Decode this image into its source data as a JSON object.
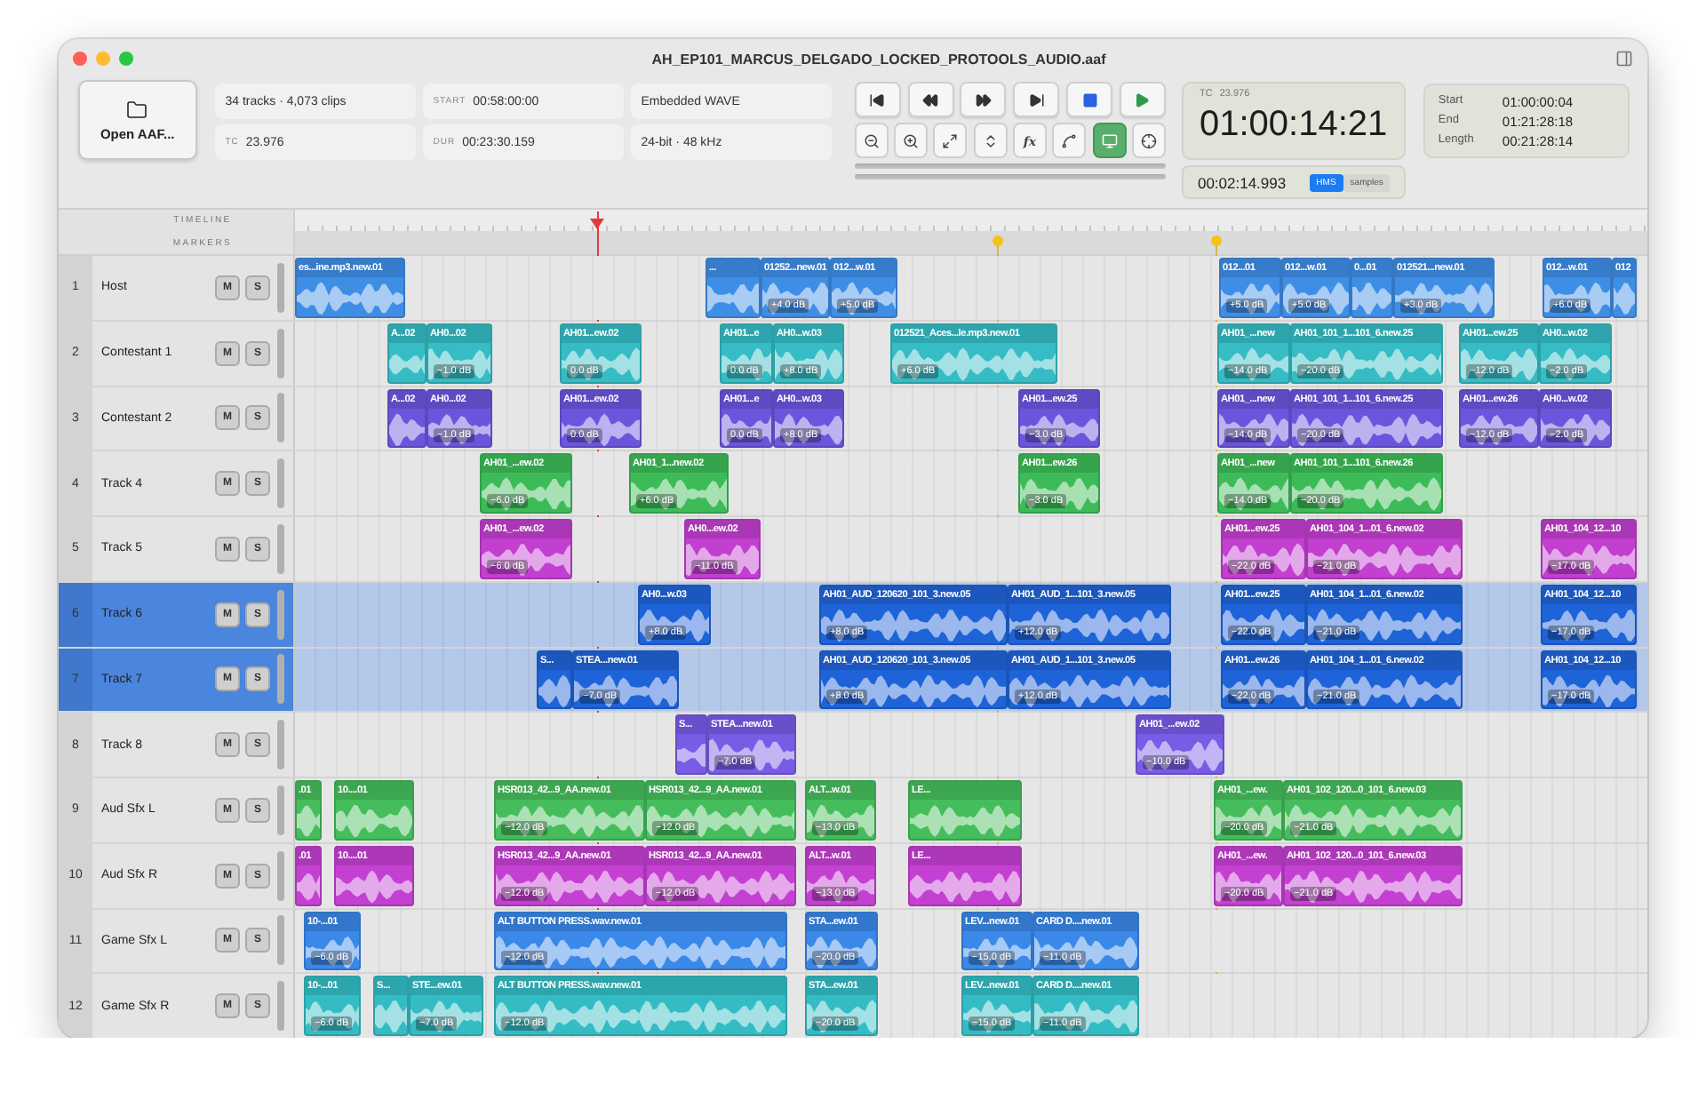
{
  "window": {
    "title": "AH_EP101_MARCUS_DELGADO_LOCKED_PROTOOLS_AUDIO.aaf"
  },
  "toolbar": {
    "open_button": "Open AAF...",
    "info": [
      {
        "value": "34 tracks · 4,073 clips"
      },
      {
        "label": "START",
        "value": "00:58:00:00"
      },
      {
        "value": "Embedded WAVE"
      },
      {
        "label": "TC",
        "value": "23.976"
      },
      {
        "label": "DUR",
        "value": "00:23:30.159"
      },
      {
        "value": "24-bit · 48 kHz"
      }
    ],
    "tools": [
      {
        "selected": false
      },
      {
        "selected": false
      },
      {
        "selected": false
      },
      {
        "selected": false
      },
      {
        "label": "fx",
        "selected": false
      },
      {
        "selected": false
      },
      {
        "selected": true
      },
      {
        "selected": false
      }
    ]
  },
  "timecode": {
    "rate_label": "TC",
    "rate": "23.976",
    "main": "01:00:14:21",
    "secondary": "00:02:14.993",
    "formats": [
      {
        "label": "HMS",
        "selected": true
      },
      {
        "label": "samples",
        "selected": false
      }
    ]
  },
  "range": [
    {
      "label": "Start",
      "value": "01:00:00:04"
    },
    {
      "label": "End",
      "value": "01:21:28:18"
    },
    {
      "label": "Length",
      "value": "00:21:28:14"
    }
  ],
  "ruler": {
    "timeline_label": "TIMELINE",
    "markers_label": "MARKERS"
  },
  "tracks": [
    {
      "number": "1",
      "name": "Host",
      "color": "#3f8ee6",
      "selected": false,
      "mute": "M",
      "solo": "S",
      "clips": [
        {
          "label": "es...ine.mp3.new.01"
        },
        {
          "label": "..."
        },
        {
          "label": "01252...new.01",
          "gain": "+4.0 dB"
        },
        {
          "label": "012...w.01",
          "gain": "+5.0 dB"
        },
        {
          "label": "012...01",
          "gain": "+5.0 dB"
        },
        {
          "label": "012...w.01",
          "gain": "+5.0 dB"
        },
        {
          "label": "0...01"
        },
        {
          "label": "012521...new.01",
          "gain": "+3.0 dB"
        },
        {
          "label": "012...w.01",
          "gain": "+6.0 dB"
        },
        {
          "label": "012"
        }
      ]
    },
    {
      "number": "2",
      "name": "Contestant 1",
      "color": "#35bcc4",
      "selected": false,
      "mute": "M",
      "solo": "S",
      "clips": [
        {
          "label": "A...02"
        },
        {
          "label": "AH0...02",
          "gain": "−1.0 dB"
        },
        {
          "label": "AH01...ew.02",
          "gain": "0.0 dB"
        },
        {
          "label": "AH01...e",
          "gain": "0.0 dB"
        },
        {
          "label": "AH0...w.03",
          "gain": "+8.0 dB"
        },
        {
          "label": "012521_Aces...le.mp3.new.01",
          "gain": "+6.0 dB"
        },
        {
          "label": "AH01_...new",
          "gain": "−14.0 dB"
        },
        {
          "label": "AH01_101_1...101_6.new.25",
          "gain": "−20.0 dB"
        },
        {
          "label": "AH01...ew.25",
          "gain": "−12.0 dB"
        },
        {
          "label": "AH0...w.02",
          "gain": "−2.0 dB"
        }
      ]
    },
    {
      "number": "3",
      "name": "Contestant 2",
      "color": "#6a56dd",
      "selected": false,
      "mute": "M",
      "solo": "S",
      "clips": [
        {
          "label": "A...02"
        },
        {
          "label": "AH0...02",
          "gain": "−1.0 dB"
        },
        {
          "label": "AH01...ew.02",
          "gain": "0.0 dB"
        },
        {
          "label": "AH01...e",
          "gain": "0.0 dB"
        },
        {
          "label": "AH0...w.03",
          "gain": "+8.0 dB"
        },
        {
          "label": "AH01...ew.25",
          "gain": "−3.0 dB"
        },
        {
          "label": "AH01_...new",
          "gain": "−14.0 dB"
        },
        {
          "label": "AH01_101_1...101_6.new.25",
          "gain": "−20.0 dB"
        },
        {
          "label": "AH01...ew.26",
          "gain": "−12.0 dB"
        },
        {
          "label": "AH0...w.02",
          "gain": "−2.0 dB"
        }
      ]
    },
    {
      "number": "4",
      "name": "Track 4",
      "color": "#3dbb58",
      "selected": false,
      "mute": "M",
      "solo": "S",
      "clips": [
        {
          "label": "AH01_...ew.02",
          "gain": "−6.0 dB"
        },
        {
          "label": "AH01_1...new.02",
          "gain": "+6.0 dB"
        },
        {
          "label": "AH01...ew.26",
          "gain": "−3.0 dB"
        },
        {
          "label": "AH01_...new",
          "gain": "−14.0 dB"
        },
        {
          "label": "AH01_101_1...101_6.new.26",
          "gain": "−20.0 dB"
        }
      ]
    },
    {
      "number": "5",
      "name": "Track 5",
      "color": "#c23fcf",
      "selected": false,
      "mute": "M",
      "solo": "S",
      "clips": [
        {
          "label": "AH01_...ew.02",
          "gain": "−6.0 dB"
        },
        {
          "label": "AH0...ew.02",
          "gain": "−11.0 dB"
        },
        {
          "label": "AH01...ew.25",
          "gain": "−22.0 dB"
        },
        {
          "label": "AH01_104_1...01_6.new.02",
          "gain": "−21.0 dB"
        },
        {
          "label": "AH01_104_12...10",
          "gain": "−17.0 dB"
        }
      ]
    },
    {
      "number": "6",
      "name": "Track 6",
      "color": "#1f63d8",
      "selected": true,
      "mute": "M",
      "solo": "S",
      "clips": [
        {
          "label": "AH0...w.03",
          "gain": "+8.0 dB"
        },
        {
          "label": "AH01_AUD_120620_101_3.new.05",
          "gain": "+8.0 dB"
        },
        {
          "label": "AH01_AUD_1...101_3.new.05",
          "gain": "+12.0 dB"
        },
        {
          "label": "AH01...ew.25",
          "gain": "−22.0 dB"
        },
        {
          "label": "AH01_104_1...01_6.new.02",
          "gain": "−21.0 dB"
        },
        {
          "label": "AH01_104_12...10",
          "gain": "−17.0 dB"
        }
      ]
    },
    {
      "number": "7",
      "name": "Track 7",
      "color": "#1f63d8",
      "selected": true,
      "mute": "M",
      "solo": "S",
      "clips": [
        {
          "label": "S..."
        },
        {
          "label": "STEA...new.01",
          "gain": "−7.0 dB"
        },
        {
          "label": "AH01_AUD_120620_101_3.new.05",
          "gain": "+8.0 dB"
        },
        {
          "label": "AH01_AUD_1...101_3.new.05",
          "gain": "+12.0 dB"
        },
        {
          "label": "AH01...ew.26",
          "gain": "−22.0 dB"
        },
        {
          "label": "AH01_104_1...01_6.new.02",
          "gain": "−21.0 dB"
        },
        {
          "label": "AH01_104_12...10",
          "gain": "−17.0 dB"
        }
      ]
    },
    {
      "number": "8",
      "name": "Track 8",
      "color": "#785ce6",
      "selected": false,
      "mute": "M",
      "solo": "S",
      "clips": [
        {
          "label": "S..."
        },
        {
          "label": "STEA...new.01",
          "gain": "−7.0 dB"
        },
        {
          "label": "AH01_...ew.02",
          "gain": "−10.0 dB"
        }
      ]
    },
    {
      "number": "9",
      "name": "Aud Sfx L",
      "color": "#45bd5c",
      "selected": false,
      "mute": "M",
      "solo": "S",
      "clips": [
        {
          "label": ".01"
        },
        {
          "label": "10....01"
        },
        {
          "label": "HSR013_42...9_AA.new.01",
          "gain": "−12.0 dB"
        },
        {
          "label": "HSR013_42...9_AA.new.01",
          "gain": "−12.0 dB"
        },
        {
          "label": "ALT...w.01",
          "gain": "−13.0 dB"
        },
        {
          "label": "LE..."
        },
        {
          "label": "AH01_...ew.",
          "gain": "−20.0 dB"
        },
        {
          "label": "AH01_102_120...0_101_6.new.03",
          "gain": "−21.0 dB"
        }
      ]
    },
    {
      "number": "10",
      "name": "Aud Sfx R",
      "color": "#c440d2",
      "selected": false,
      "mute": "M",
      "solo": "S",
      "clips": [
        {
          "label": ".01"
        },
        {
          "label": "10....01"
        },
        {
          "label": "HSR013_42...9_AA.new.01",
          "gain": "−12.0 dB"
        },
        {
          "label": "HSR013_42...9_AA.new.01",
          "gain": "−12.0 dB"
        },
        {
          "label": "ALT...w.01",
          "gain": "−13.0 dB"
        },
        {
          "label": "LE..."
        },
        {
          "label": "AH01_...ew.",
          "gain": "−20.0 dB"
        },
        {
          "label": "AH01_102_120...0_101_6.new.03",
          "gain": "−21.0 dB"
        }
      ]
    },
    {
      "number": "11",
      "name": "Game Sfx L",
      "color": "#3a88e8",
      "selected": false,
      "mute": "M",
      "solo": "S",
      "clips": [
        {
          "label": "10-...01",
          "gain": "−6.0 dB"
        },
        {
          "label": "ALT BUTTON PRESS.wav.new.01",
          "gain": "−12.0 dB"
        },
        {
          "label": "STA...ew.01",
          "gain": "−20.0 dB"
        },
        {
          "label": "LEV...new.01",
          "gain": "−15.0 dB"
        },
        {
          "label": "CARD D....new.01",
          "gain": "−11.0 dB"
        }
      ]
    },
    {
      "number": "12",
      "name": "Game Sfx R",
      "color": "#34bcc4",
      "selected": false,
      "mute": "M",
      "solo": "S",
      "clips": [
        {
          "label": "10-...01",
          "gain": "−6.0 dB"
        },
        {
          "label": "S..."
        },
        {
          "label": "STE...ew.01",
          "gain": "−7.0 dB"
        },
        {
          "label": "ALT BUTTON PRESS.wav.new.01",
          "gain": "−12.0 dB"
        },
        {
          "label": "STA...ew.01",
          "gain": "−20.0 dB"
        },
        {
          "label": "LEV...new.01",
          "gain": "−15.0 dB"
        },
        {
          "label": "CARD D....new.01",
          "gain": "−11.0 dB"
        }
      ]
    }
  ]
}
